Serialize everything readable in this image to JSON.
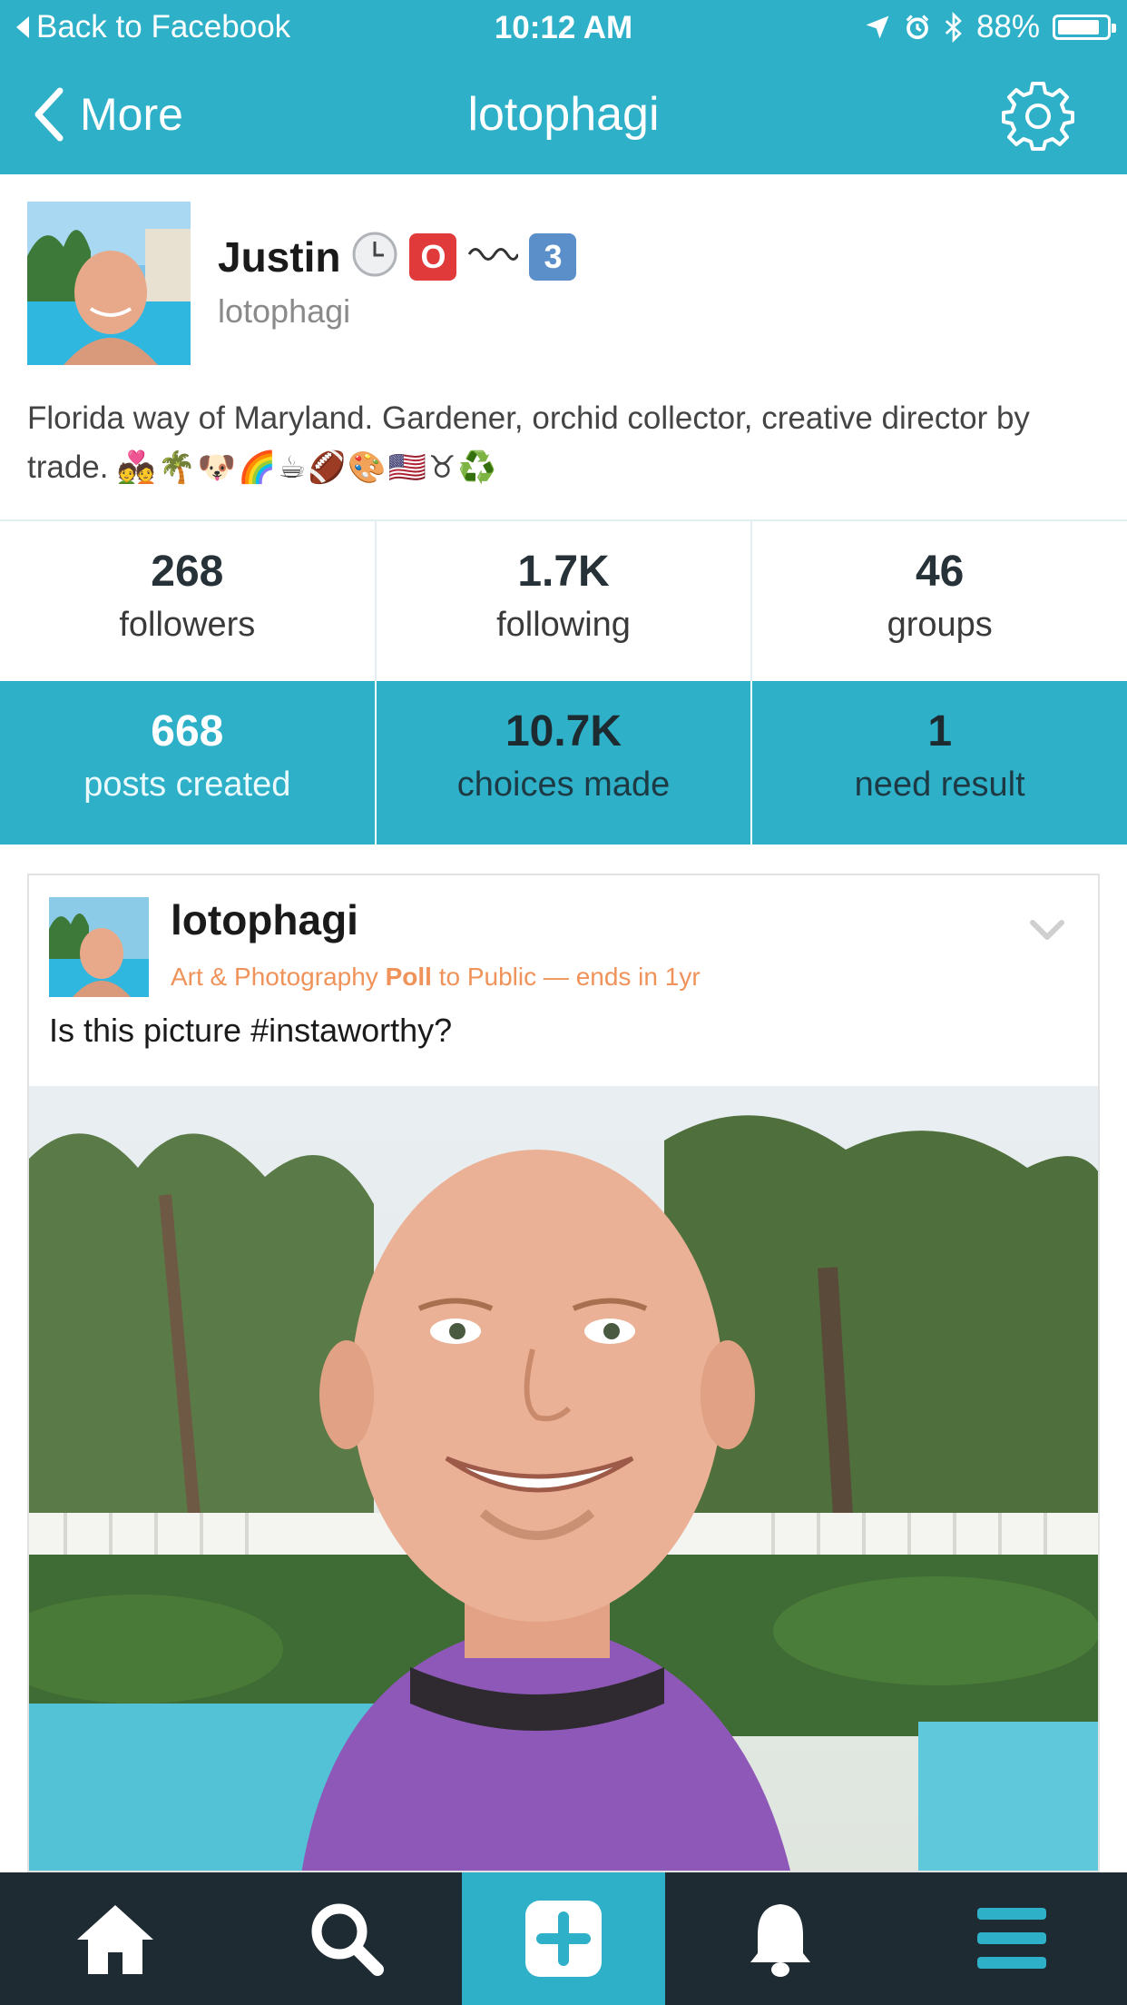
{
  "status_bar": {
    "back_label": "Back to Facebook",
    "time": "10:12 AM",
    "battery": "88%",
    "battery_level": 0.88
  },
  "nav": {
    "back_label": "More",
    "title": "lotophagi"
  },
  "profile": {
    "name": "Justin",
    "handle": "lotophagi",
    "bio": "Florida way of Maryland. Gardener, orchid collector, creative director by trade.",
    "name_emojis": [
      "🕒",
      "🅾️",
      "〰️",
      "3️⃣"
    ],
    "bio_emojis": "💑🌴🐶🌈☕🏈🎨🇺🇸♉♻️"
  },
  "stats": [
    {
      "value": "268",
      "label": "followers"
    },
    {
      "value": "1.7K",
      "label": "following"
    },
    {
      "value": "46",
      "label": "groups"
    }
  ],
  "activity": [
    {
      "value": "668",
      "label": "posts created"
    },
    {
      "value": "10.7K",
      "label": "choices made"
    },
    {
      "value": "1",
      "label": "need result"
    }
  ],
  "post": {
    "user": "lotophagi",
    "category": "Art & Photography",
    "type": "Poll",
    "audience": "to Public",
    "separator": "—",
    "ends": "ends in 1yr",
    "question": "Is this picture #instaworthy?"
  },
  "tabbar": {
    "icons": [
      "home-icon",
      "search-icon",
      "plus-icon",
      "bell-icon",
      "menu-icon"
    ]
  },
  "colors": {
    "accent": "#2db0c8",
    "tabbar_bg": "#1e2b32",
    "meta_orange": "#f0935a"
  }
}
